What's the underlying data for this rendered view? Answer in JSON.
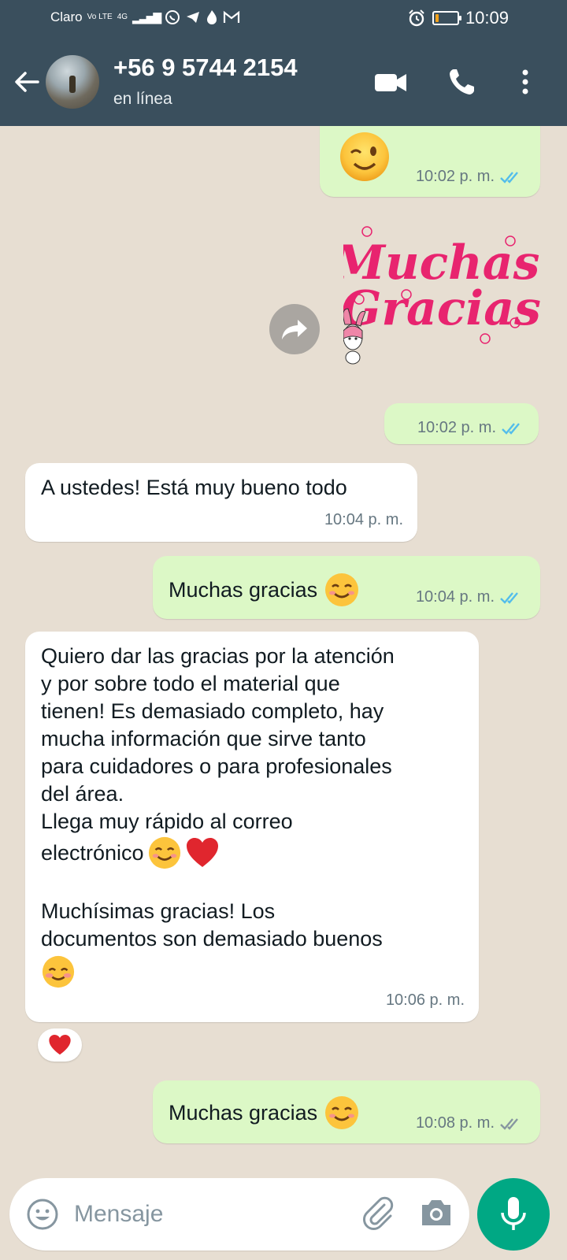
{
  "status_bar": {
    "carrier": "Claro",
    "network": "4G",
    "volte": "Vo LTE",
    "time": "10:09",
    "battery_level": 0.15
  },
  "header": {
    "contact_name": "+56 9 5744 2154",
    "contact_status": "en línea"
  },
  "messages": [
    {
      "direction": "outgoing",
      "type": "emoji",
      "emoji": "wink-face",
      "time": "10:02 p. m.",
      "status": "read"
    },
    {
      "direction": "outgoing",
      "type": "sticker",
      "sticker_line1": "Muchas",
      "sticker_line2": "Gracias",
      "time": "10:02 p. m.",
      "status": "read"
    },
    {
      "direction": "incoming",
      "type": "text",
      "text": "A ustedes! Está muy bueno todo",
      "time": "10:04 p. m."
    },
    {
      "direction": "outgoing",
      "type": "text",
      "text": "Muchas gracias",
      "emoji": "smiling-face",
      "time": "10:04 p. m.",
      "status": "read"
    },
    {
      "direction": "incoming",
      "type": "text",
      "lines": [
        "Quiero dar las gracias por la atención",
        "y por sobre todo el material que",
        "tienen! Es demasiado completo, hay",
        "mucha información que sirve tanto",
        "para cuidadores o para profesionales",
        "del área.",
        "Llega muy rápido al correo",
        "electrónico",
        "",
        "Muchísimas gracias! Los",
        "documentos son demasiado buenos"
      ],
      "time": "10:06 p. m.",
      "reaction": "red-heart"
    },
    {
      "direction": "outgoing",
      "type": "text",
      "text": "Muchas gracias",
      "emoji": "smiling-face",
      "time": "10:08 p. m.",
      "status": "delivered"
    }
  ],
  "composer": {
    "placeholder": "Mensaje"
  },
  "colors": {
    "header": "#3a4f5d",
    "outgoing_bubble": "#dcf8c6",
    "incoming_bubble": "#ffffff",
    "read_ticks": "#53bdeb",
    "mic_button": "#00a884",
    "sticker_pink": "#e8246f"
  }
}
